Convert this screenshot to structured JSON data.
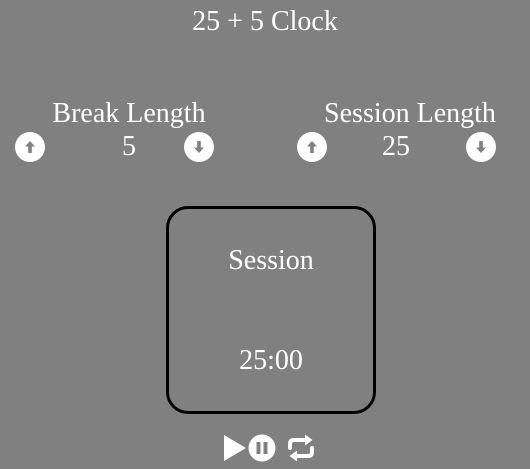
{
  "app": {
    "title": "25 + 5 Clock"
  },
  "break": {
    "label": "Break Length",
    "value": "5",
    "increment_icon": "arrow-circle-up-icon",
    "decrement_icon": "arrow-circle-down-icon"
  },
  "session": {
    "label": "Session Length",
    "value": "25",
    "increment_icon": "arrow-circle-up-icon",
    "decrement_icon": "arrow-circle-down-icon"
  },
  "timer": {
    "label": "Session",
    "time_left": "25:00"
  },
  "controls": {
    "play_icon": "play-icon",
    "pause_icon": "pause-circle-icon",
    "reset_icon": "repeat-icon"
  },
  "colors": {
    "background": "#808080",
    "text": "#ffffff",
    "timer_border": "#000000",
    "icon_fill": "#ffffff",
    "icon_glyph": "#808080"
  }
}
